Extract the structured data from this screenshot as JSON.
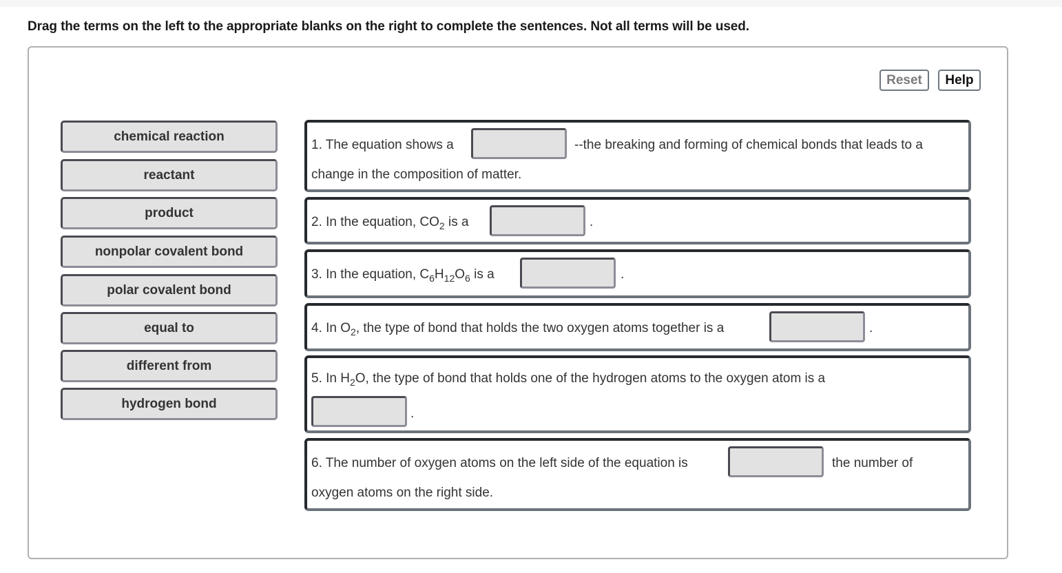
{
  "instructions": "Drag the terms on the left to the appropriate blanks on the right to complete the sentences. Not all terms will be used.",
  "buttons": {
    "reset": "Reset",
    "help": "Help"
  },
  "terms": [
    "chemical reaction",
    "reactant",
    "product",
    "nonpolar covalent bond",
    "polar covalent bond",
    "equal to",
    "different from",
    "hydrogen bond"
  ],
  "questions": {
    "q1": {
      "before": "1. The equation shows a",
      "after": "--the breaking and forming of chemical bonds that leads to a",
      "line2": "change in the composition of matter."
    },
    "q2": {
      "before": "2. In the equation, CO",
      "sub1": "2",
      "mid": " is a",
      "after": "."
    },
    "q3": {
      "before": "3. In the equation, C",
      "sub1": "6",
      "h": "H",
      "sub2": "12",
      "o": "O",
      "sub3": "6",
      "mid": " is a",
      "after": "."
    },
    "q4": {
      "before": "4. In O",
      "sub1": "2",
      "mid": ", the type of bond that holds the two oxygen atoms together is a",
      "after": "."
    },
    "q5": {
      "before": "5. In H",
      "sub1": "2",
      "mid": "O, the type of bond that holds one of the hydrogen atoms to the oxygen atom is a",
      "after": "."
    },
    "q6": {
      "before": "6. The number of oxygen atoms on the left side of the equation is",
      "after": "the number of",
      "line2": "oxygen atoms on the right side."
    }
  }
}
